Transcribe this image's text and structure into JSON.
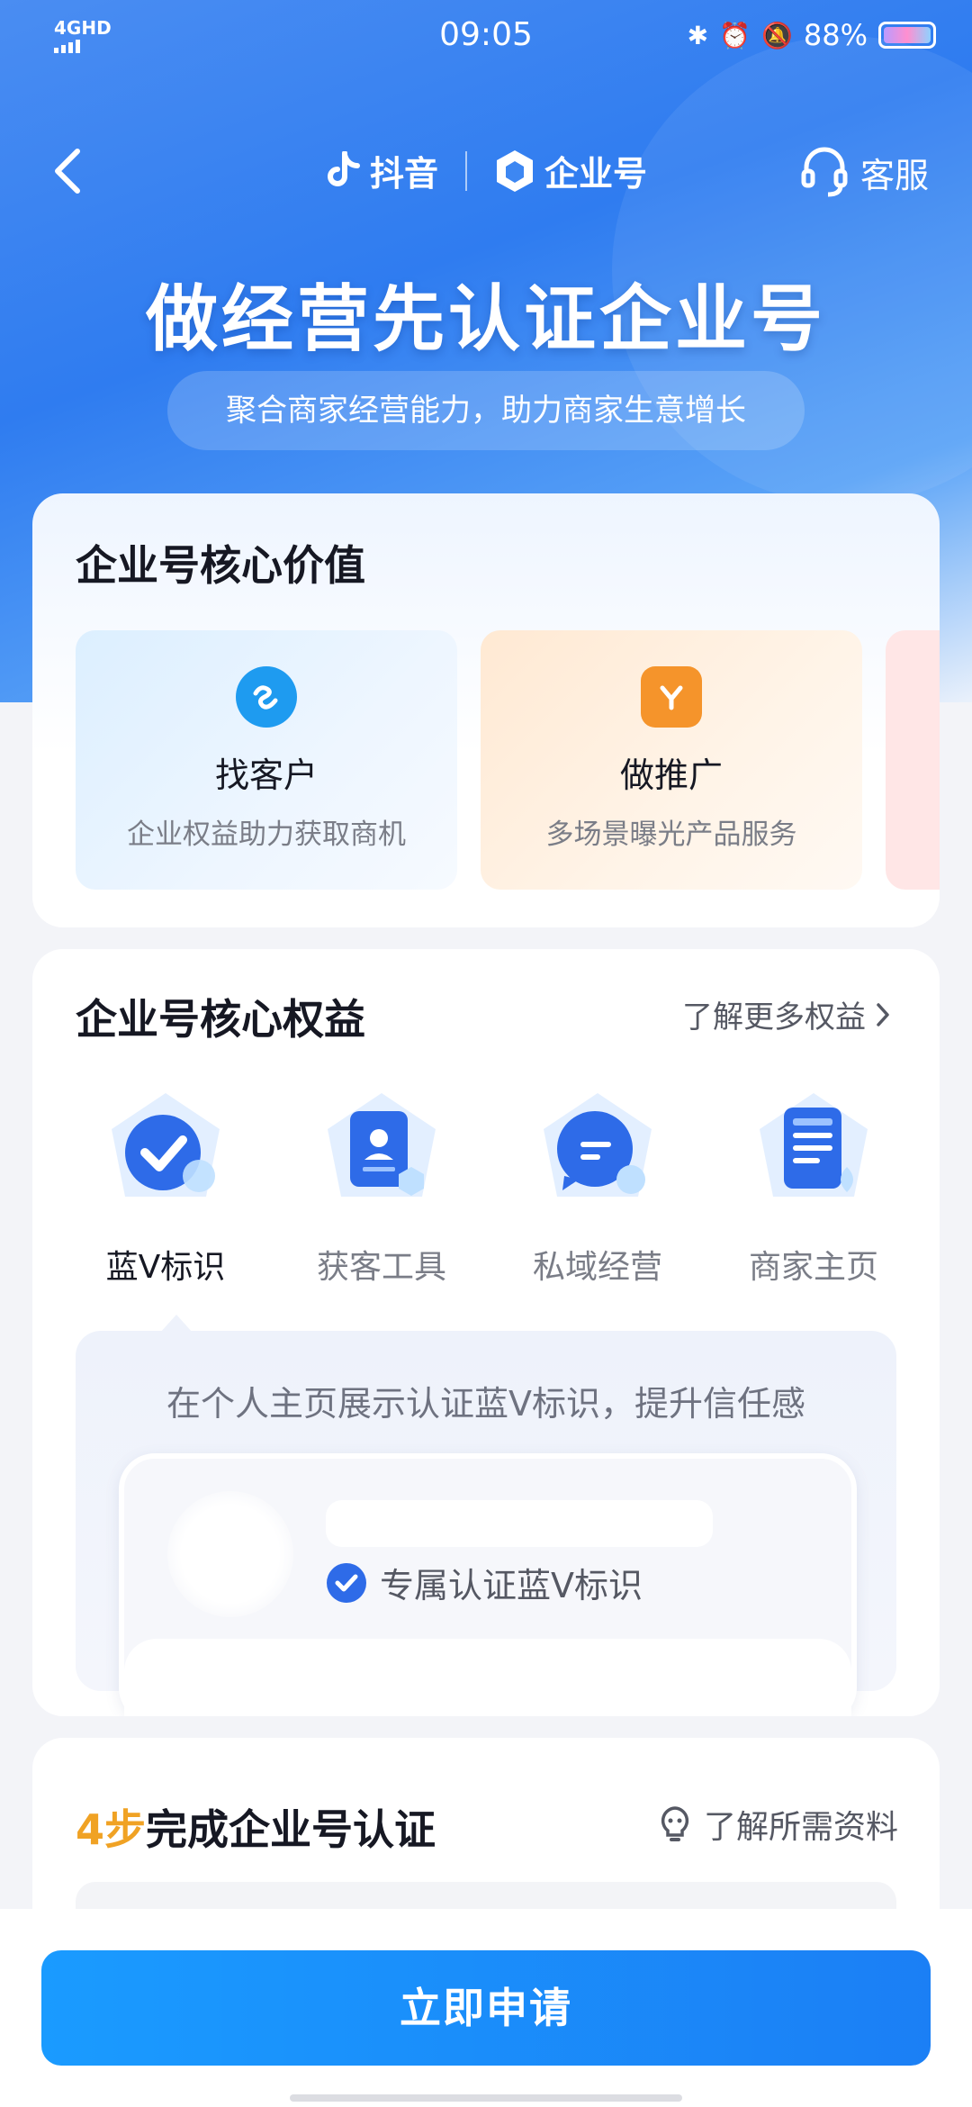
{
  "status_bar": {
    "network": "4GHD",
    "time": "09:05",
    "battery": "88%"
  },
  "nav": {
    "brand_douyin": "抖音",
    "brand_enterprise": "企业号",
    "service": "客服"
  },
  "hero": {
    "title": "做经营先认证企业号",
    "subtitle": "聚合商家经营能力，助力商家生意增长"
  },
  "core_value": {
    "title": "企业号核心价值",
    "items": [
      {
        "title": "找客户",
        "subtitle": "企业权益助力获取商机",
        "icon": "find-customer-icon",
        "color": "#1e9bf0"
      },
      {
        "title": "做推广",
        "subtitle": "多场景曝光产品服务",
        "icon": "promote-icon",
        "color": "#f5942b"
      }
    ]
  },
  "core_benefits": {
    "title": "企业号核心权益",
    "more": "了解更多权益",
    "items": [
      {
        "label": "蓝V标识",
        "icon": "blue-v-check-icon"
      },
      {
        "label": "获客工具",
        "icon": "contact-card-icon"
      },
      {
        "label": "私域经营",
        "icon": "chat-bubble-icon"
      },
      {
        "label": "商家主页",
        "icon": "store-page-icon"
      }
    ],
    "selected_index": 0,
    "demo_caption": "在个人主页展示认证蓝V标识，提升信任感",
    "demo_badge": "专属认证蓝V标识"
  },
  "steps": {
    "count": "4步",
    "title": "完成企业号认证",
    "need": "了解所需资料"
  },
  "cta": {
    "apply": "立即申请"
  },
  "colors": {
    "brand_blue": "#1b8cf5",
    "accent_orange": "#f0a224"
  }
}
